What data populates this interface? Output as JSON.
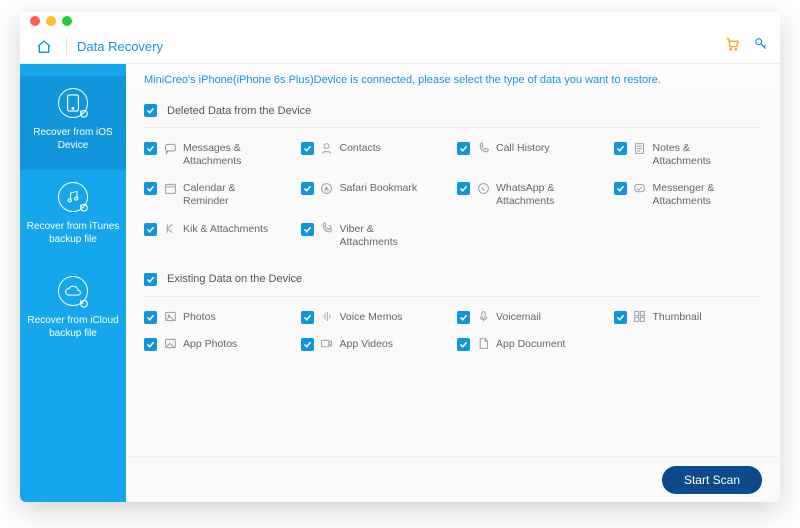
{
  "header": {
    "app_title": "Data Recovery"
  },
  "sidebar": [
    {
      "key": "ios",
      "label": "Recover from iOS Device",
      "active": true
    },
    {
      "key": "itunes",
      "label": "Recover from iTunes backup file",
      "active": false
    },
    {
      "key": "icloud",
      "label": "Recover from iCloud backup file",
      "active": false
    }
  ],
  "banner": "MiniCreo's iPhone(iPhone 6s Plus)Device is connected, please select the type of data you want to restore.",
  "sections": [
    {
      "title": "Deleted Data from the Device",
      "checked": true,
      "items": [
        {
          "icon": "message",
          "label": "Messages & Attachments"
        },
        {
          "icon": "contact",
          "label": "Contacts"
        },
        {
          "icon": "phone",
          "label": "Call History"
        },
        {
          "icon": "notes",
          "label": "Notes & Attachments"
        },
        {
          "icon": "calendar",
          "label": "Calendar & Reminder"
        },
        {
          "icon": "safari",
          "label": "Safari Bookmark"
        },
        {
          "icon": "whatsapp",
          "label": "WhatsApp & Attachments"
        },
        {
          "icon": "messenger",
          "label": "Messenger & Attachments"
        },
        {
          "icon": "kik",
          "label": "Kik & Attachments"
        },
        {
          "icon": "viber",
          "label": "Viber & Attachments"
        }
      ]
    },
    {
      "title": "Existing Data on the Device",
      "checked": true,
      "items": [
        {
          "icon": "photos",
          "label": "Photos"
        },
        {
          "icon": "voice",
          "label": "Voice Memos"
        },
        {
          "icon": "mic",
          "label": "Voicemail"
        },
        {
          "icon": "thumb",
          "label": "Thumbnail"
        },
        {
          "icon": "photos2",
          "label": "App Photos"
        },
        {
          "icon": "video",
          "label": "App Videos"
        },
        {
          "icon": "doc",
          "label": "App Document"
        }
      ]
    }
  ],
  "footer": {
    "scan_label": "Start Scan"
  }
}
